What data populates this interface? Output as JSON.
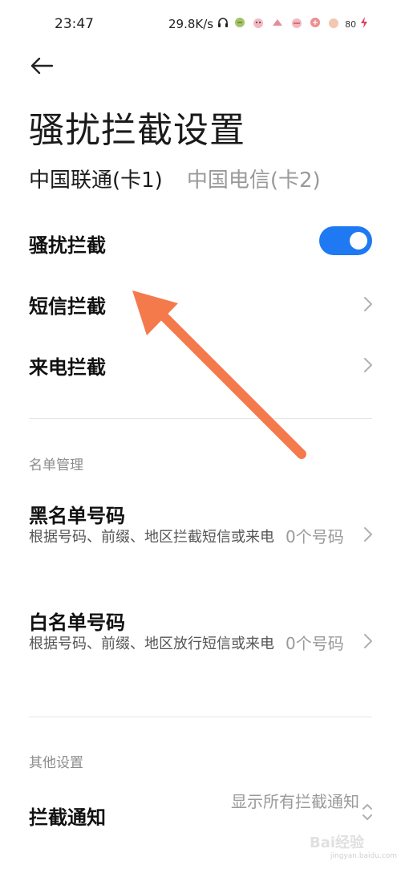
{
  "status_bar": {
    "time": "23:47",
    "speed": "29.8K/s",
    "battery": "80",
    "icons": [
      "headphones-icon",
      "plant-icon",
      "hd-icon",
      "signal-icon",
      "hd-icon",
      "signal-icon",
      "app-icon",
      "battery-icon",
      "charging-icon"
    ]
  },
  "page": {
    "title": "骚扰拦截设置"
  },
  "sim_tabs": [
    {
      "label": "中国联通(卡1)",
      "active": true
    },
    {
      "label": "中国电信(卡2)",
      "active": false
    }
  ],
  "settings": {
    "harassment_block": {
      "label": "骚扰拦截",
      "enabled": true
    },
    "sms_block": {
      "label": "短信拦截"
    },
    "call_block": {
      "label": "来电拦截"
    }
  },
  "list_management": {
    "header": "名单管理",
    "blacklist": {
      "title": "黑名单号码",
      "desc": "根据号码、前缀、地区拦截短信或来电",
      "value": "0个号码"
    },
    "whitelist": {
      "title": "白名单号码",
      "desc": "根据号码、前缀、地区放行短信或来电",
      "value": "0个号码"
    }
  },
  "other_settings": {
    "header": "其他设置",
    "block_notify": {
      "label": "拦截通知",
      "value": "显示所有拦截通知"
    }
  },
  "colors": {
    "accent": "#1f79f2",
    "annotation_arrow": "#f47a4b"
  },
  "watermark": {
    "text": "Bai经验",
    "sub": "jingyan.baidu.com"
  }
}
